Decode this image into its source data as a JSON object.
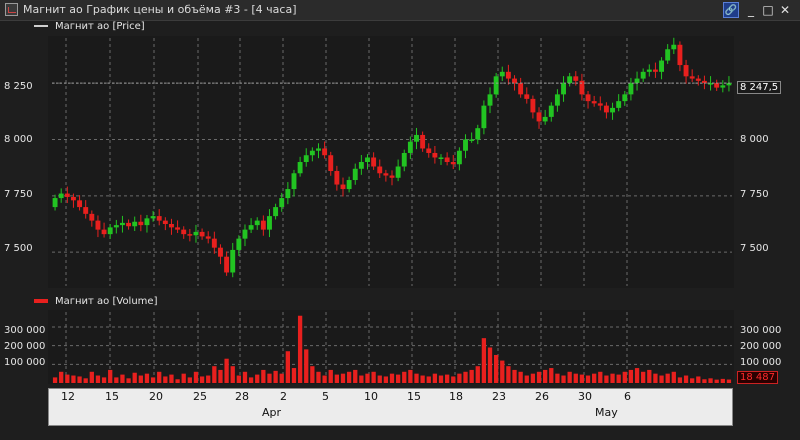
{
  "window": {
    "title": "Магнит ао График цены и объёма #3 - [4 часа]",
    "controls": {
      "link": "🔗",
      "minimize": "_",
      "maximize": "□",
      "close": "✕"
    }
  },
  "colors": {
    "up": "#22c422",
    "down": "#e8201e",
    "volume": "#e8201e",
    "grid": "#6a6a6a"
  },
  "price_panel": {
    "legend": "Магнит ао [Price]",
    "y_ticks_left": [
      "8 250",
      "8 000",
      "7 750",
      "7 500"
    ],
    "y_ticks_right": [
      "8 000",
      "7 750",
      "7 500"
    ],
    "last_value": "8 247,5"
  },
  "volume_panel": {
    "legend": "Магнит ао [Volume]",
    "y_ticks_left": [
      "300 000",
      "200 000",
      "100 000"
    ],
    "y_ticks_right": [
      "300 000",
      "200 000",
      "100 000"
    ],
    "last_value": "18 487"
  },
  "x_axis": {
    "day_labels": [
      "12",
      "15",
      "20",
      "25",
      "28",
      "2",
      "5",
      "10",
      "15",
      "18",
      "23",
      "26",
      "30",
      "6"
    ],
    "month_labels": [
      "Apr",
      "May"
    ]
  },
  "chart_data": [
    {
      "type": "candlestick",
      "series": [
        {
          "name": "Магнит ао [Price]",
          "close": [
            7740,
            7760,
            7745,
            7730,
            7700,
            7670,
            7640,
            7600,
            7580,
            7610,
            7620,
            7630,
            7615,
            7635,
            7620,
            7650,
            7660,
            7640,
            7625,
            7610,
            7600,
            7580,
            7575,
            7590,
            7570,
            7560,
            7520,
            7480,
            7410,
            7510,
            7560,
            7600,
            7620,
            7640,
            7600,
            7660,
            7700,
            7740,
            7780,
            7850,
            7900,
            7930,
            7950,
            7960,
            7930,
            7860,
            7800,
            7780,
            7820,
            7870,
            7900,
            7920,
            7880,
            7850,
            7840,
            7830,
            7880,
            7940,
            7990,
            8020,
            7960,
            7940,
            7920,
            7920,
            7900,
            7890,
            7950,
            8000,
            8000,
            8050,
            8150,
            8200,
            8280,
            8300,
            8270,
            8250,
            8200,
            8180,
            8120,
            8080,
            8100,
            8150,
            8200,
            8250,
            8280,
            8260,
            8200,
            8170,
            8160,
            8150,
            8120,
            8140,
            8170,
            8200,
            8250,
            8270,
            8300,
            8310,
            8300,
            8350,
            8400,
            8420,
            8330,
            8280,
            8270,
            8260,
            8250,
            8250,
            8230,
            8240,
            8250
          ],
          "open": [
            7700,
            7740,
            7760,
            7745,
            7730,
            7700,
            7670,
            7640,
            7600,
            7580,
            7610,
            7620,
            7630,
            7615,
            7635,
            7620,
            7650,
            7660,
            7640,
            7625,
            7610,
            7600,
            7580,
            7575,
            7590,
            7570,
            7560,
            7520,
            7480,
            7410,
            7510,
            7560,
            7600,
            7620,
            7640,
            7600,
            7660,
            7700,
            7740,
            7780,
            7850,
            7900,
            7930,
            7950,
            7960,
            7930,
            7860,
            7800,
            7780,
            7820,
            7870,
            7900,
            7920,
            7880,
            7850,
            7840,
            7830,
            7880,
            7940,
            7990,
            8020,
            7960,
            7940,
            7920,
            7920,
            7900,
            7890,
            7950,
            8000,
            8000,
            8050,
            8150,
            8200,
            8280,
            8300,
            8270,
            8250,
            8200,
            8180,
            8120,
            8080,
            8100,
            8150,
            8200,
            8250,
            8280,
            8260,
            8200,
            8170,
            8160,
            8150,
            8120,
            8140,
            8170,
            8200,
            8250,
            8270,
            8300,
            8310,
            8300,
            8350,
            8400,
            8420,
            8330,
            8280,
            8270,
            8260,
            8250,
            8250,
            8230,
            8240
          ]
        },
        {
          "name": "Магнит ао [Volume]",
          "values": [
            30000,
            60000,
            45000,
            40000,
            35000,
            25000,
            60000,
            40000,
            30000,
            70000,
            30000,
            45000,
            25000,
            55000,
            40000,
            50000,
            30000,
            60000,
            35000,
            45000,
            20000,
            50000,
            30000,
            60000,
            35000,
            40000,
            90000,
            70000,
            130000,
            90000,
            40000,
            60000,
            30000,
            45000,
            70000,
            50000,
            65000,
            50000,
            170000,
            80000,
            360000,
            180000,
            90000,
            60000,
            40000,
            70000,
            45000,
            50000,
            60000,
            70000,
            40000,
            50000,
            60000,
            40000,
            35000,
            50000,
            45000,
            60000,
            70000,
            50000,
            40000,
            35000,
            50000,
            40000,
            45000,
            35000,
            50000,
            60000,
            70000,
            90000,
            240000,
            190000,
            150000,
            120000,
            90000,
            70000,
            60000,
            40000,
            50000,
            60000,
            70000,
            80000,
            50000,
            40000,
            60000,
            50000,
            45000,
            40000,
            50000,
            60000,
            40000,
            50000,
            45000,
            60000,
            70000,
            80000,
            60000,
            70000,
            50000,
            40000,
            50000,
            60000,
            30000,
            40000,
            25000,
            35000,
            20000,
            25000,
            18000,
            22000,
            18487
          ]
        }
      ],
      "ylim": [
        7350,
        8450
      ],
      "volume_ylim": [
        0,
        380000
      ]
    }
  ]
}
